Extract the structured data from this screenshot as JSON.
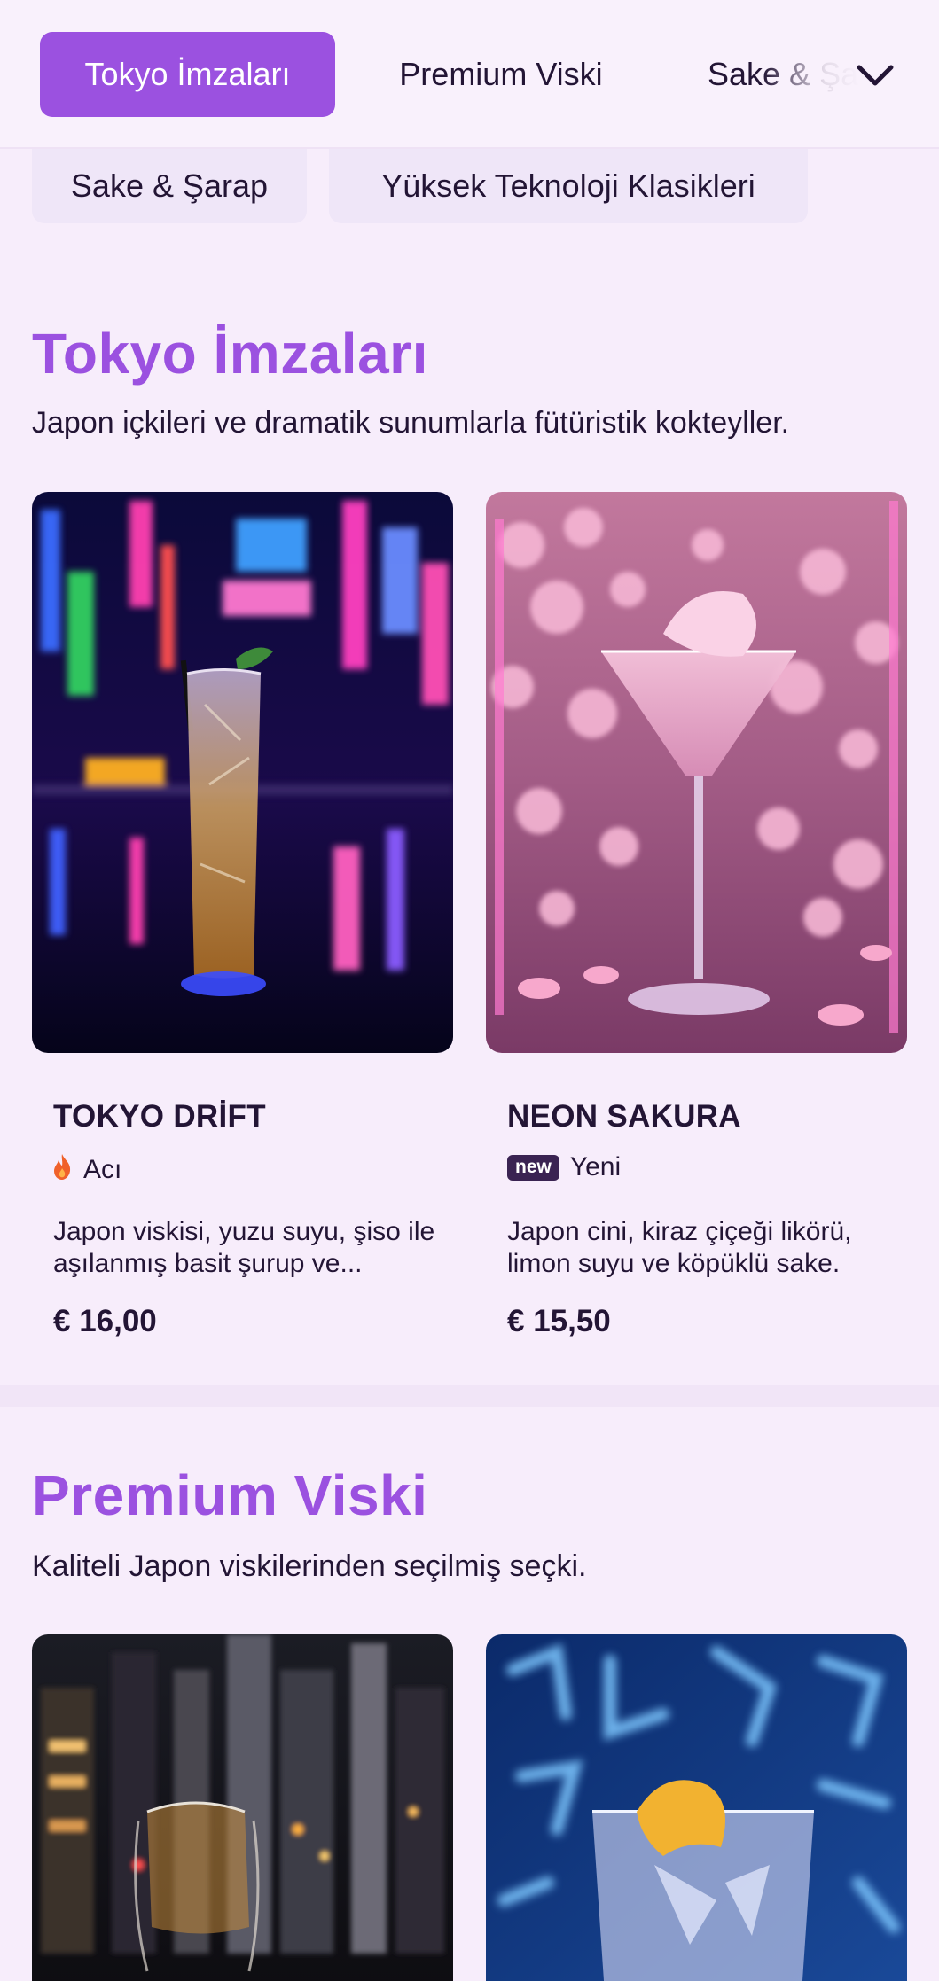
{
  "tabs": [
    {
      "label": "Tokyo İmzaları",
      "active": true
    },
    {
      "label": "Premium Viski",
      "active": false
    },
    {
      "label": "Sake & Şarap",
      "active": false
    }
  ],
  "chips": [
    {
      "label": "Sake & Şarap"
    },
    {
      "label": "Yüksek Teknoloji Klasikleri"
    }
  ],
  "sections": [
    {
      "title": "Tokyo İmzaları",
      "description": "Japon içkileri ve dramatik sunumlarla fütüristik kokteyller.",
      "items": [
        {
          "name": "TOKYO DRİFT",
          "tag_icon": "flame-icon",
          "tag": "Acı",
          "description": "Japon viskisi, yuzu suyu, şiso ile aşılanmış basit şurup ve...",
          "price": "€ 16,00"
        },
        {
          "name": "NEON SAKURA",
          "tag_badge": "new",
          "tag": "Yeni",
          "description": "Japon cini, kiraz çiçeği likörü, limon suyu ve köpüklü sake.",
          "price": "€ 15,50"
        }
      ]
    },
    {
      "title": "Premium Viski",
      "description": "Kaliteli Japon viskilerinden seçilmiş seçki.",
      "items": []
    }
  ],
  "colors": {
    "accent": "#9b51e0",
    "text": "#231535",
    "background": "#f7edfb"
  }
}
